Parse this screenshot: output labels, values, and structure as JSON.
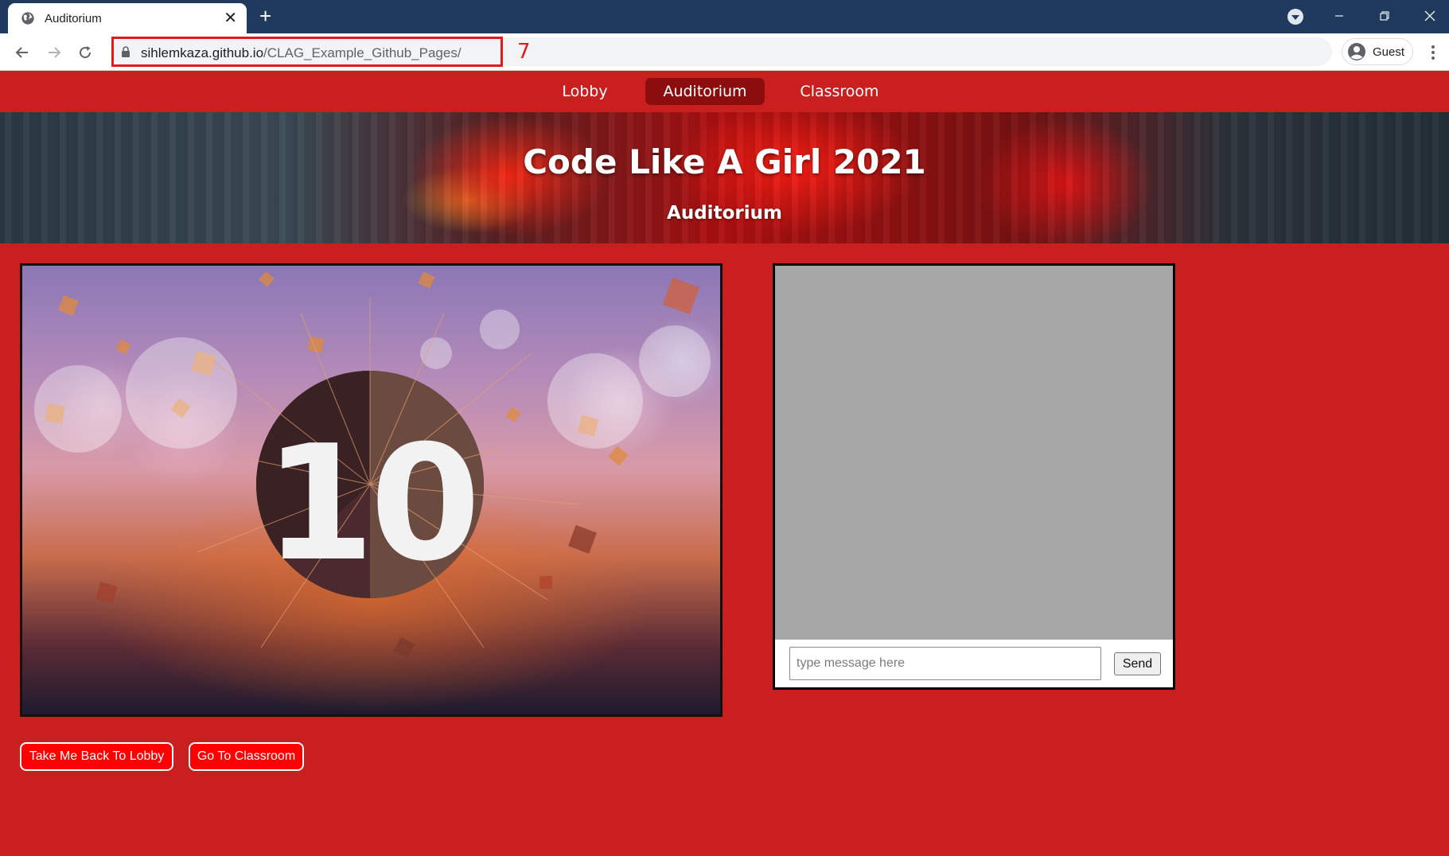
{
  "browser": {
    "tab_title": "Auditorium",
    "new_tab_label": "+",
    "url_host": "sihlemkaza.github.io",
    "url_path": "/CLAG_Example_Github_Pages/",
    "annotation_number": "7",
    "profile_label": "Guest"
  },
  "nav": {
    "items": [
      {
        "label": "Lobby",
        "active": false
      },
      {
        "label": "Auditorium",
        "active": true
      },
      {
        "label": "Classroom",
        "active": false
      }
    ]
  },
  "hero": {
    "title": "Code Like A Girl 2021",
    "subtitle": "Auditorium"
  },
  "video": {
    "countdown_number": "10"
  },
  "chat": {
    "input_placeholder": "type message here",
    "send_label": "Send"
  },
  "buttons": {
    "lobby_label": "Take Me Back To Lobby",
    "classroom_label": "Go To Classroom"
  },
  "colors": {
    "page_bg": "#c91f1f",
    "nav_active_bg": "#8c0d0d",
    "button_bg": "#ff0000",
    "tabstrip_bg": "#1f3a5c",
    "annotation": "#e01b1b"
  },
  "icons": [
    "globe-icon",
    "close-icon",
    "back-arrow-icon",
    "forward-arrow-icon",
    "reload-icon",
    "lock-icon",
    "account-icon",
    "more-vert-icon",
    "tab-search-icon",
    "minimize-icon",
    "restore-icon",
    "window-close-icon"
  ]
}
